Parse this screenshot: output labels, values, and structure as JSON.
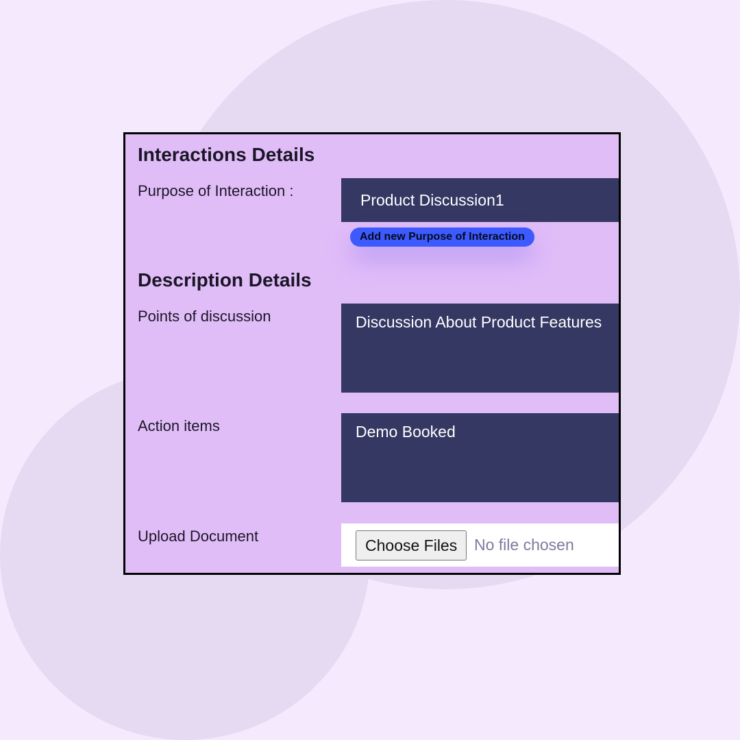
{
  "interactions": {
    "title": "Interactions Details",
    "purpose_label": "Purpose of Interaction :",
    "purpose_value": "Product Discussion1",
    "add_purpose_label": "Add new Purpose of Interaction"
  },
  "description": {
    "title": "Description Details",
    "points_label": "Points of discussion",
    "points_value": "Discussion About Product Features",
    "action_label": "Action items",
    "action_value": "Demo Booked"
  },
  "upload": {
    "label": "Upload Document",
    "button_label": "Choose Files",
    "status_text": "No file chosen"
  },
  "colors": {
    "page_background": "#f5e9fd",
    "decor_circle": "#e6daf3",
    "panel_background": "#e1bdf8",
    "field_background": "#343862",
    "pill_background": "#3d5afe"
  }
}
